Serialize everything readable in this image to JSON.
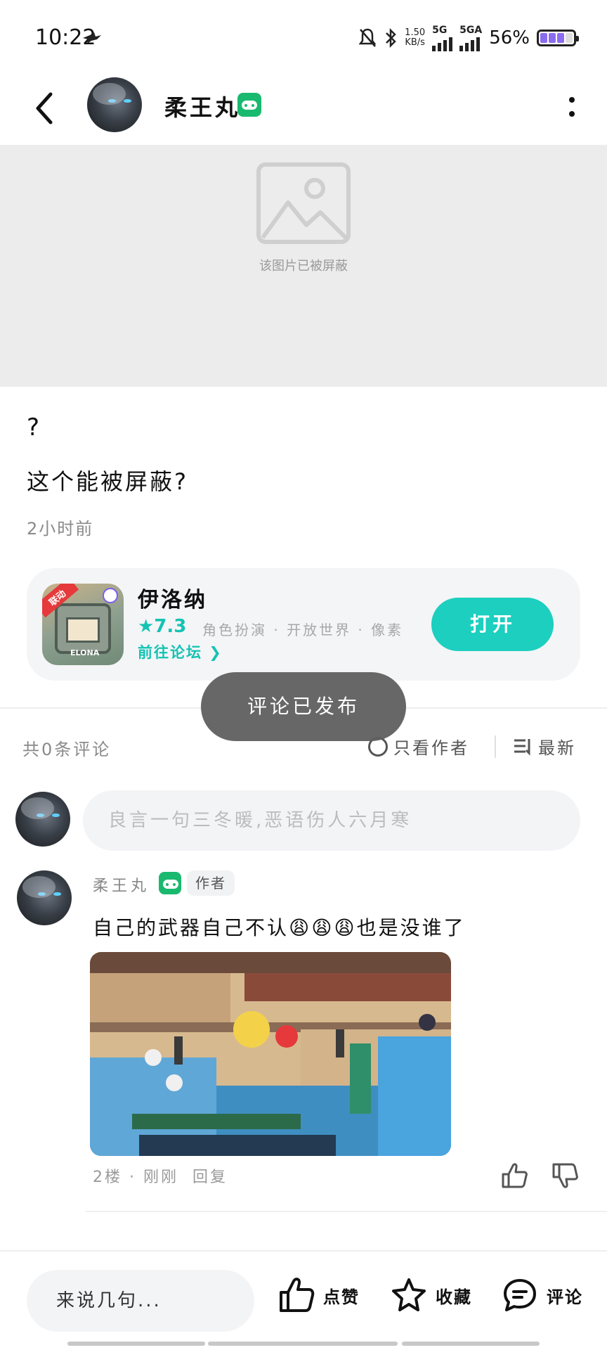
{
  "status_bar": {
    "time": "10:22",
    "speed_value": "1.50",
    "speed_unit": "KB/s",
    "net1": "5G",
    "net2": "5GA",
    "battery": "56%"
  },
  "header": {
    "username": "柔王丸",
    "badge_icon": "game-controller-icon"
  },
  "blocked_image": {
    "text": "该图片已被屏蔽"
  },
  "post": {
    "title": "?",
    "body": "这个能被屏蔽?",
    "time": "2小时前"
  },
  "game_card": {
    "name": "伊洛纳",
    "rating": "★7.3",
    "tags": "角色扮演 · 开放世界 · 像素",
    "forum_link": "前往论坛 ❯",
    "icon_tag": "联动",
    "icon_text": "ELONA",
    "open_button": "打开",
    "accent_color": "#1ccfbf"
  },
  "toast": {
    "text": "评论已发布"
  },
  "comments_header": {
    "count": "共0条评论",
    "only_author": "只看作者",
    "sort": "最新"
  },
  "comment_input": {
    "placeholder": "良言一句三冬暖,恶语伤人六月寒"
  },
  "comment": {
    "username": "柔王丸",
    "author_tag": "作者",
    "text": "自己的武器自己不认😩😩😩也是没谁了",
    "meta_floor": "2楼 · 刚刚",
    "reply": "回复"
  },
  "bottom_bar": {
    "input_label": "来说几句...",
    "like_label": "点赞",
    "fav_label": "收藏",
    "comment_label": "评论"
  }
}
